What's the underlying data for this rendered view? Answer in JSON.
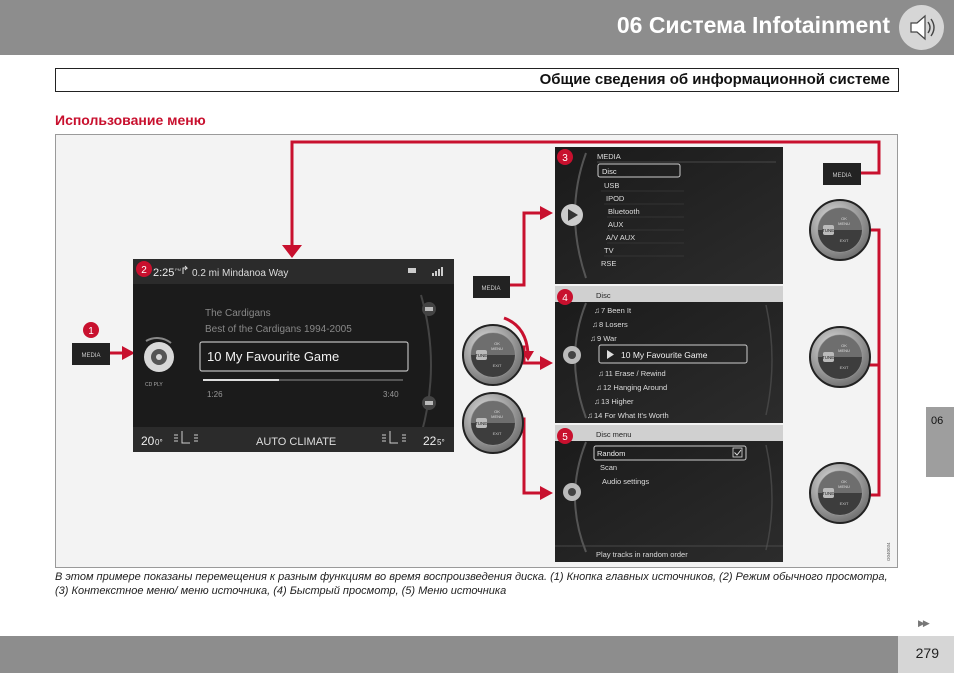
{
  "header": {
    "title": "06  Система Infotainment"
  },
  "subtitle": "Общие сведения об информационной системе",
  "section_title": "Использование меню",
  "caption": "В этом примере показаны перемещения к разным функциям во время воспроизведения диска. (1) Кнопка главных источников, (2) Режим обычного просмотра, (3) Контекстное меню/ меню источника, (4) Быстрый просмотр, (5) Меню источника",
  "side_tab": "06",
  "page_number": "279",
  "figure": {
    "badges": [
      "1",
      "2",
      "3",
      "4",
      "5"
    ],
    "media_button": "MEDIA",
    "image_code": "G040034",
    "main_screen": {
      "time": "2:25",
      "time_suffix": "PM",
      "nav": "0.2 mi Mindanoa Way",
      "artist": "The Cardigans",
      "album": "Best of the Cardigans 1994-2005",
      "track": "10 My Favourite Game",
      "mode": "CD PLY",
      "elapsed": "1:26",
      "total": "3:40",
      "progress": 0.38,
      "temp_left": "20",
      "temp_left_frac": "0°",
      "climate": "AUTO CLIMATE",
      "temp_right": "22",
      "temp_right_frac": "5°"
    },
    "knob": {
      "ok": "OK",
      "menu": "MENU",
      "tune": "TUNE",
      "exit": "EXIT"
    },
    "media_menu": {
      "title": "MEDIA",
      "items": [
        "Disc",
        "USB",
        "IPOD",
        "Bluetooth",
        "AUX",
        "A/V AUX",
        "TV",
        "RSE"
      ]
    },
    "disc_list": {
      "title": "Disc",
      "items": [
        "7 Been It",
        "8 Losers",
        "9 War",
        "10 My Favourite Game",
        "11 Erase / Rewind",
        "12 Hanging Around",
        "13 Higher",
        "14 For What It's Worth"
      ]
    },
    "disc_menu": {
      "title": "Disc menu",
      "items": [
        "Random",
        "Scan",
        "Audio settings"
      ],
      "footer": "Play tracks in random order"
    }
  }
}
